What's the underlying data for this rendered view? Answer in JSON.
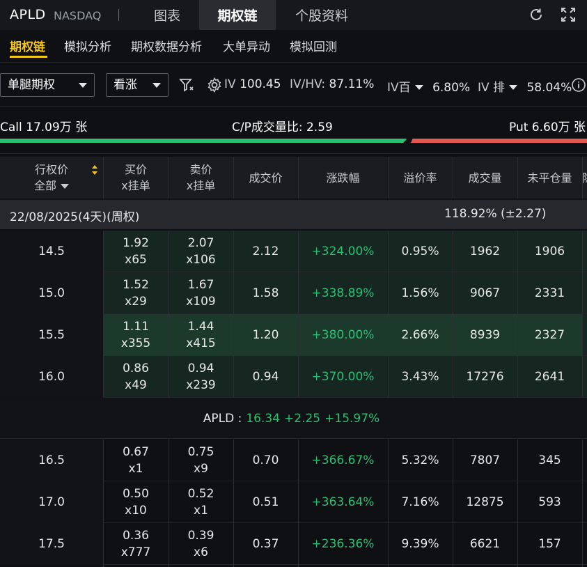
{
  "header": {
    "ticker": "APLD",
    "exchange": "NASDAQ",
    "tabs": [
      {
        "label": "图表",
        "active": false
      },
      {
        "label": "期权链",
        "active": true
      },
      {
        "label": "个股资料",
        "active": false
      }
    ],
    "icons": [
      "refresh-icon",
      "fullscreen-icon"
    ]
  },
  "subtabs": [
    {
      "label": "期权链",
      "active": true
    },
    {
      "label": "模拟分析",
      "active": false
    },
    {
      "label": "期权数据分析",
      "active": false
    },
    {
      "label": "大单异动",
      "active": false
    },
    {
      "label": "模拟回测",
      "active": false
    }
  ],
  "filters": {
    "strategy": "单腿期权",
    "direction": "看涨",
    "iv_label": "IV",
    "iv_value": "100.45",
    "ivhv_label": "IV/HV:",
    "ivhv_value": "87.11%",
    "ivrank_label": "IV百",
    "ivrank_value": "6.80%",
    "ivpct_label": "IV 排",
    "ivpct_value": "58.04%"
  },
  "volume": {
    "call_text": "Call 17.09万 张",
    "cp_text": "C/P成交量比:  2.59",
    "put_text": "Put 6.60万 张",
    "call_fraction": 0.7,
    "colors": {
      "call": "#2dbf74",
      "put": "#e85b55"
    }
  },
  "table": {
    "headers": {
      "strike_l1": "行权价",
      "strike_l2": "全部",
      "bid_l1": "买价",
      "bid_l2": "x挂单",
      "ask_l1": "卖价",
      "ask_l2": "x挂单",
      "last": "成交价",
      "change": "涨跌幅",
      "premium": "溢价率",
      "volume": "成交量",
      "oi": "未平仓量",
      "extra": "隐"
    },
    "expiry": {
      "date": "22/08/2025(4天)(周权)",
      "iv": "118.92% (±2.27)"
    },
    "rows_itm": [
      {
        "strike": "14.5",
        "bid": "1.92",
        "bid_size": "x65",
        "ask": "2.07",
        "ask_size": "x106",
        "last": "2.12",
        "change": "+324.00%",
        "premium": "0.95%",
        "volume": "1962",
        "oi": "1906"
      },
      {
        "strike": "15.0",
        "bid": "1.52",
        "bid_size": "x29",
        "ask": "1.67",
        "ask_size": "x109",
        "last": "1.58",
        "change": "+338.89%",
        "premium": "1.56%",
        "volume": "9067",
        "oi": "2331"
      },
      {
        "strike": "15.5",
        "bid": "1.11",
        "bid_size": "x355",
        "ask": "1.44",
        "ask_size": "x415",
        "last": "1.20",
        "change": "+380.00%",
        "premium": "2.66%",
        "volume": "8939",
        "oi": "2327"
      },
      {
        "strike": "16.0",
        "bid": "0.86",
        "bid_size": "x49",
        "ask": "0.94",
        "ask_size": "x239",
        "last": "0.94",
        "change": "+370.00%",
        "premium": "3.43%",
        "volume": "17276",
        "oi": "2641"
      }
    ],
    "spot": {
      "symbol": "APLD :",
      "price": "16.34",
      "change": "+2.25",
      "change_pct": "+15.97%"
    },
    "rows_otm": [
      {
        "strike": "16.5",
        "bid": "0.67",
        "bid_size": "x1",
        "ask": "0.75",
        "ask_size": "x9",
        "last": "0.70",
        "change": "+366.67%",
        "premium": "5.32%",
        "volume": "7807",
        "oi": "345"
      },
      {
        "strike": "17.0",
        "bid": "0.50",
        "bid_size": "x10",
        "ask": "0.52",
        "ask_size": "x1",
        "last": "0.51",
        "change": "+363.64%",
        "premium": "7.16%",
        "volume": "12875",
        "oi": "593"
      },
      {
        "strike": "17.5",
        "bid": "0.36",
        "bid_size": "x777",
        "ask": "0.39",
        "ask_size": "x6",
        "last": "0.37",
        "change": "+236.36%",
        "premium": "9.39%",
        "volume": "6621",
        "oi": "157"
      }
    ]
  }
}
